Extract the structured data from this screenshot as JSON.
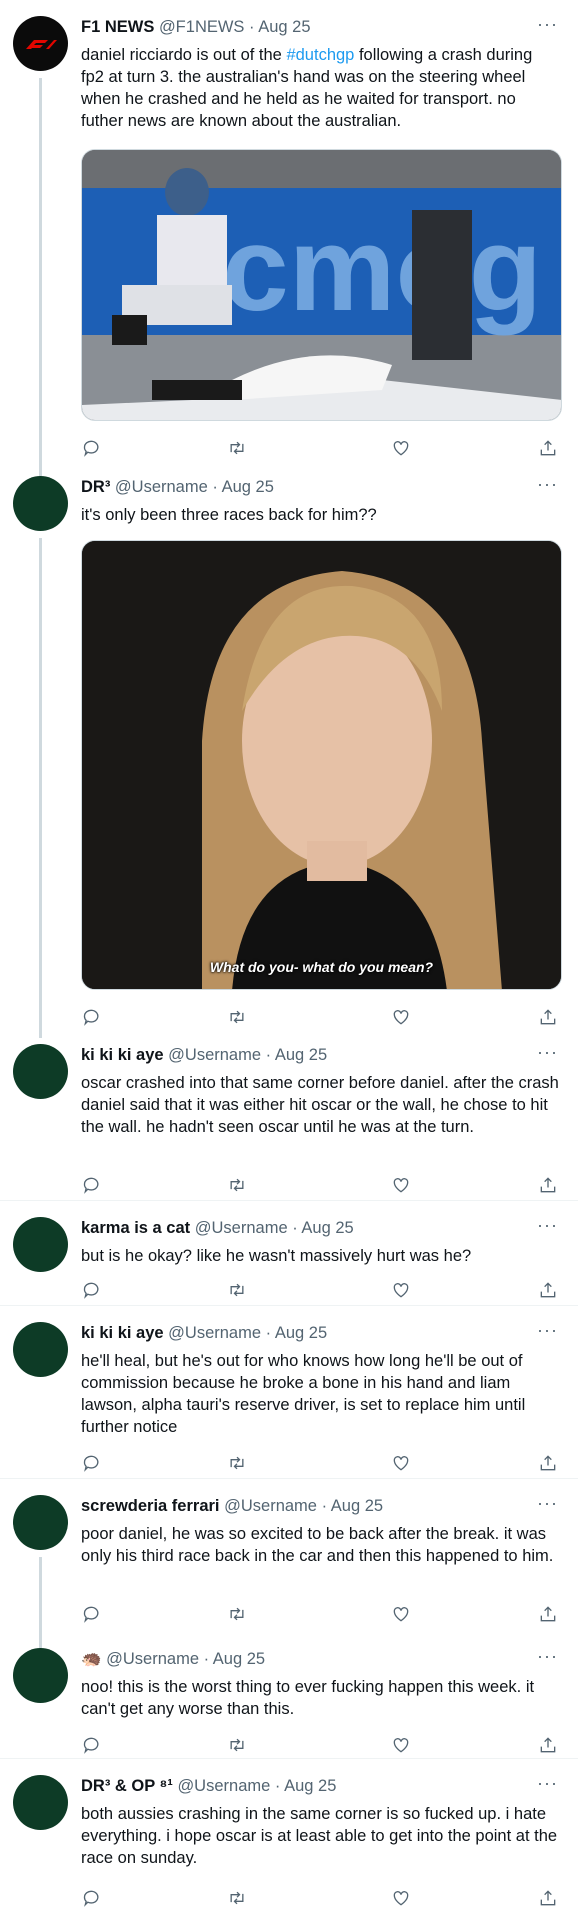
{
  "tweets": [
    {
      "name": "F1 NEWS",
      "handle": "@F1NEWS",
      "date": "Aug 25",
      "text_before": "daniel ricciardo is out of the ",
      "hashtag": "#dutchgp",
      "text_after": " following a crash during fp2 at turn 3. the australian's hand was on the steering wheel when he crashed and he held as he waited for transport. no futher news are known about the australian."
    },
    {
      "name": "DR³",
      "handle": "@Username",
      "date": "Aug 25",
      "text": "it's only been three races back for him??",
      "media_caption": "What do you- what do you mean?"
    },
    {
      "name": "ki ki ki aye",
      "handle": "@Username",
      "date": "Aug 25",
      "text": "oscar crashed into that same corner before daniel. after the crash daniel said that it was either hit oscar or the wall, he chose to hit the wall. he hadn't seen oscar until he was at the turn."
    },
    {
      "name": "karma is a cat",
      "handle": "@Username",
      "date": "Aug 25",
      "text": "but is he okay? like he wasn't massively hurt was he?"
    },
    {
      "name": "ki ki ki aye",
      "handle": "@Username",
      "date": "Aug 25",
      "text": "he'll heal, but he's out for who knows how long he'll be out of commission because he broke a bone in his hand and liam lawson, alpha tauri's reserve driver, is set to replace him until further notice"
    },
    {
      "name": "screwderia ferrari",
      "handle": "@Username",
      "date": "Aug 25",
      "text": "poor daniel, he was so excited to be back after the break. it was only his third race back in the car and then this happened to him."
    },
    {
      "name": "🦔",
      "handle": "@Username",
      "date": "Aug 25",
      "text": "noo! this is the worst thing to ever fucking happen this week. it can't get any worse than this."
    },
    {
      "name": "DR³ & OP ⁸¹",
      "handle": "@Username",
      "date": "Aug 25",
      "text": "both aussies crashing in the same corner is so fucked up. i hate everything. i hope oscar is at least able to get into the point at the race on sunday."
    }
  ],
  "ui": {
    "dot": "·",
    "more": "···"
  },
  "colors": {
    "link": "#1d9bf0",
    "muted": "#536471",
    "avatar": "#0d3b26"
  }
}
